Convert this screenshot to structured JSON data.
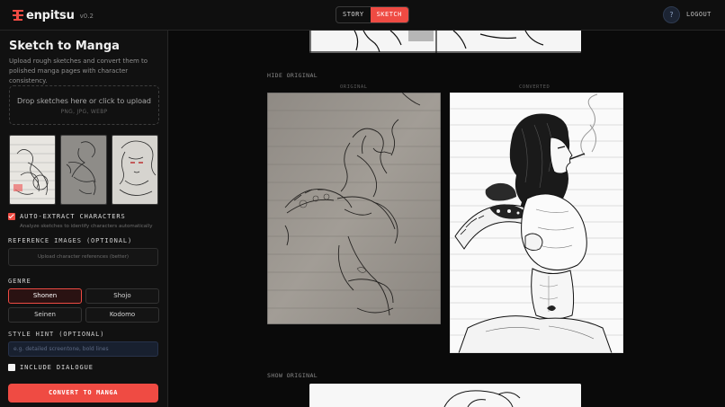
{
  "app": {
    "name": "enpitsu",
    "version": "v0.2"
  },
  "header": {
    "modes": [
      "STORY",
      "SKETCH"
    ],
    "active_mode": "SKETCH",
    "help_label": "?",
    "logout_label": "LOGOUT"
  },
  "sidebar": {
    "title": "Sketch to Manga",
    "description": "Upload rough sketches and convert them to polished manga pages with character consistency.",
    "dropzone": {
      "main": "Drop sketches here or click to upload",
      "formats": "PNG, JPG, WEBP"
    },
    "auto_extract": {
      "label": "AUTO-EXTRACT CHARACTERS",
      "hint": "Analyze sketches to identify characters automatically",
      "checked": true
    },
    "reference": {
      "label": "REFERENCE IMAGES (OPTIONAL)",
      "placeholder": "Upload character references (better)"
    },
    "genre": {
      "label": "GENRE",
      "options": [
        "Shonen",
        "Shojo",
        "Seinen",
        "Kodomo"
      ],
      "selected": "Shonen"
    },
    "style_hint": {
      "label": "STYLE HINT (OPTIONAL)",
      "placeholder": "e.g. detailed screentone, bold lines"
    },
    "include_dialogue": {
      "label": "INCLUDE DIALOGUE",
      "checked": false
    },
    "convert_label": "CONVERT TO MANGA"
  },
  "main": {
    "hide_original": "HIDE ORIGINAL",
    "show_original": "SHOW ORIGINAL",
    "original_label": "ORIGINAL",
    "converted_label": "CONVERTED"
  },
  "colors": {
    "accent": "#ef4b43",
    "background": "#0a0a0a",
    "sidebar": "#111111"
  }
}
